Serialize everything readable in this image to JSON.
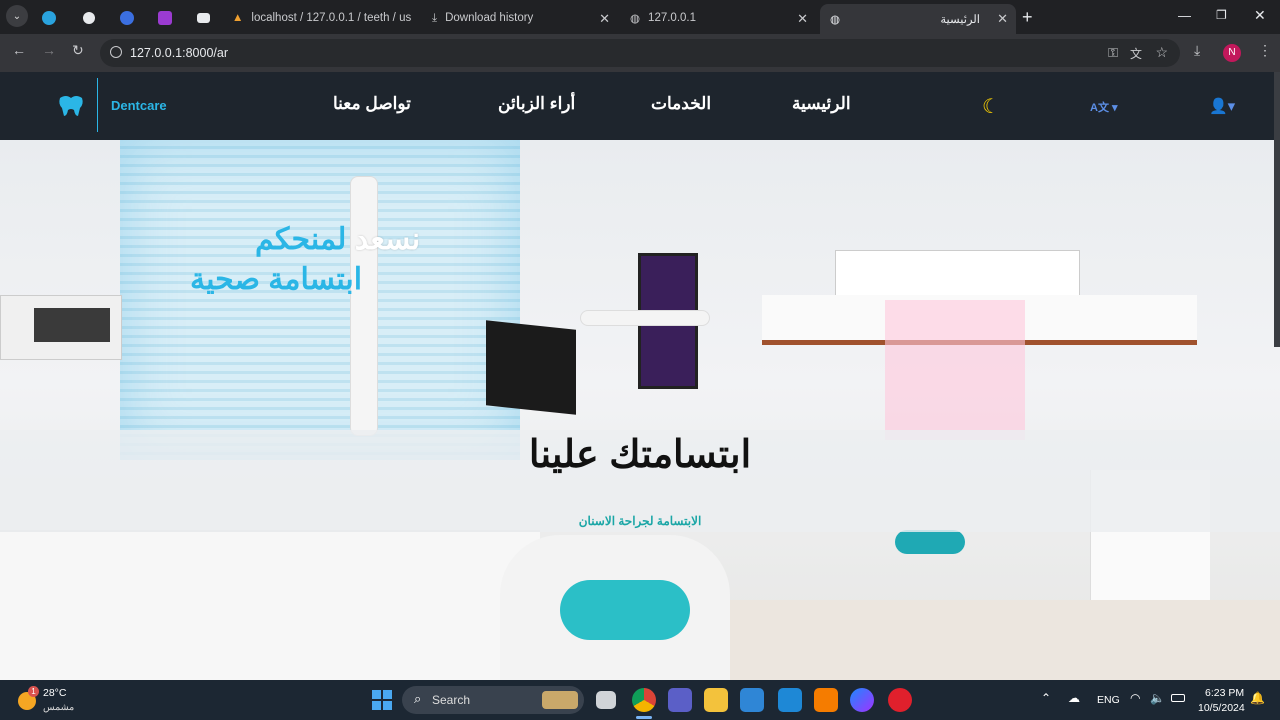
{
  "browser": {
    "tabs": [
      {
        "label": "localhost / 127.0.0.1 / teeth / us"
      },
      {
        "label": "Download history"
      },
      {
        "label": "127.0.0.1"
      },
      {
        "label": "الرئيسية"
      }
    ],
    "new_tab": "+",
    "url": "127.0.0.1:8000/ar",
    "profile_initial": "N"
  },
  "site": {
    "brand": "Dentcare",
    "nav": {
      "home": "الرئيسية",
      "services": "الخدمات",
      "reviews": "أراء الزبائن",
      "contact": "تواصل معنا"
    },
    "hero": {
      "line1_a": "نسعد",
      "line1_b": "لمنحكم",
      "line2": "ابتسامة صحية",
      "title": "ابتسامتك علينا",
      "subtitle": "الابتسامة لجراحة الاسنان"
    }
  },
  "taskbar": {
    "weather_temp": "28°C",
    "weather_desc": "مشمس",
    "weather_badge": "1",
    "search": "Search",
    "lang": "ENG",
    "time": "6:23 PM",
    "date": "10/5/2024"
  },
  "colors": {
    "accent": "#2bb6e6",
    "nav_bg": "#1e252d",
    "teal": "#1aa6a6"
  }
}
